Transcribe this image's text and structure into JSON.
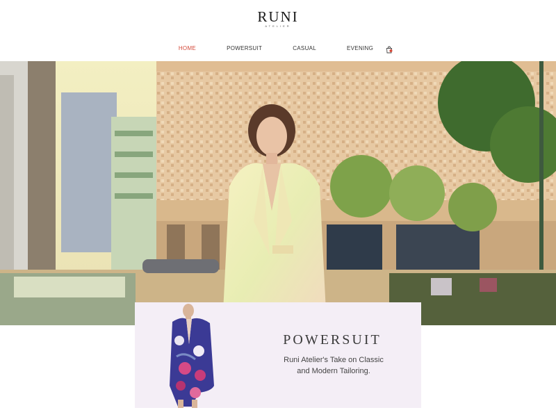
{
  "brand": {
    "name": "RUNI",
    "tagline": "ATELIER"
  },
  "nav": {
    "items": [
      {
        "label": "HOME",
        "active": true
      },
      {
        "label": "POWERSUIT",
        "active": false
      },
      {
        "label": "CASUAL",
        "active": false
      },
      {
        "label": "EVENING",
        "active": false
      }
    ],
    "cart_icon": "shopping-bag-icon",
    "active_color": "#d44a3a"
  },
  "promo": {
    "title": "POWERSUIT",
    "text_line1": "Runi Atelier's Take on Classic",
    "text_line2": "and Modern Tailoring."
  }
}
